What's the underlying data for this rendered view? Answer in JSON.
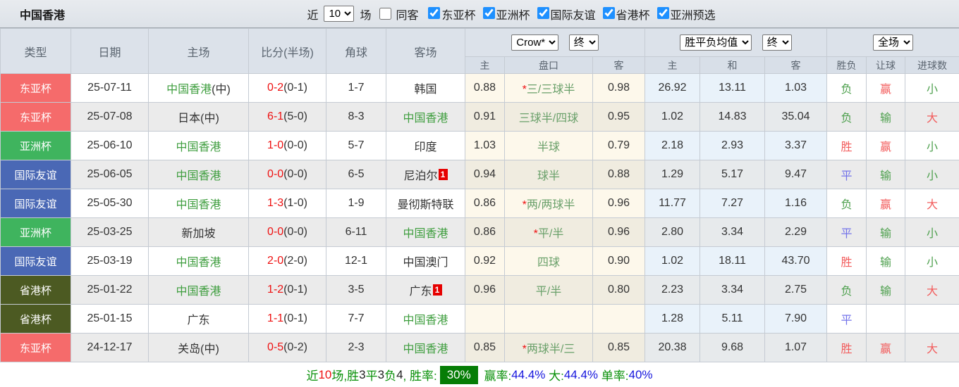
{
  "topbar": {
    "title": "中国香港",
    "recent_label": "近",
    "recent_value": "10",
    "games_label": "场",
    "same_venue": {
      "label": "同客",
      "checked": false
    },
    "leagues": [
      {
        "label": "东亚杯",
        "checked": true
      },
      {
        "label": "亚洲杯",
        "checked": true
      },
      {
        "label": "国际友谊",
        "checked": true
      },
      {
        "label": "省港杯",
        "checked": true
      },
      {
        "label": "亚洲预选",
        "checked": true
      }
    ]
  },
  "header": {
    "cols": [
      "类型",
      "日期",
      "主场",
      "比分(半场)",
      "角球",
      "客场"
    ],
    "crow_select": "Crow*",
    "crow_time_select": "终",
    "euro_select": "胜平负均值",
    "euro_time_select": "终",
    "period_select": "全场",
    "sub": [
      "主",
      "盘口",
      "客",
      "主",
      "和",
      "客",
      "胜负",
      "让球",
      "进球数"
    ]
  },
  "type_colors": {
    "东亚杯": "red",
    "亚洲杯": "green",
    "国际友谊": "blue",
    "省港杯": "olive"
  },
  "rows": [
    {
      "type": "东亚杯",
      "date": "25-07-11",
      "home": {
        "name": "中国香港",
        "suffix": "(中)",
        "green": true,
        "badge": ""
      },
      "score_ft": "0-2",
      "score_ht": "(0-1)",
      "corner": "1-7",
      "away": {
        "name": "韩国",
        "suffix": "",
        "green": false,
        "badge": ""
      },
      "crow_home": "0.88",
      "handicap": "*三/三球半",
      "crow_away": "0.98",
      "euro_home": "26.92",
      "euro_draw": "13.11",
      "euro_away": "1.03",
      "res_wdl": {
        "text": "负",
        "color": "green"
      },
      "res_handicap": {
        "text": "赢",
        "color": "red"
      },
      "res_goals": {
        "text": "小",
        "color": "green"
      }
    },
    {
      "type": "东亚杯",
      "date": "25-07-08",
      "home": {
        "name": "日本",
        "suffix": "(中)",
        "green": false,
        "badge": ""
      },
      "score_ft": "6-1",
      "score_ht": "(5-0)",
      "corner": "8-3",
      "away": {
        "name": "中国香港",
        "suffix": "",
        "green": true,
        "badge": ""
      },
      "crow_home": "0.91",
      "handicap": "三球半/四球",
      "crow_away": "0.95",
      "euro_home": "1.02",
      "euro_draw": "14.83",
      "euro_away": "35.04",
      "res_wdl": {
        "text": "负",
        "color": "green"
      },
      "res_handicap": {
        "text": "输",
        "color": "green"
      },
      "res_goals": {
        "text": "大",
        "color": "red"
      }
    },
    {
      "type": "亚洲杯",
      "date": "25-06-10",
      "home": {
        "name": "中国香港",
        "suffix": "",
        "green": true,
        "badge": ""
      },
      "score_ft": "1-0",
      "score_ht": "(0-0)",
      "corner": "5-7",
      "away": {
        "name": "印度",
        "suffix": "",
        "green": false,
        "badge": ""
      },
      "crow_home": "1.03",
      "handicap": "半球",
      "crow_away": "0.79",
      "euro_home": "2.18",
      "euro_draw": "2.93",
      "euro_away": "3.37",
      "res_wdl": {
        "text": "胜",
        "color": "red"
      },
      "res_handicap": {
        "text": "赢",
        "color": "red"
      },
      "res_goals": {
        "text": "小",
        "color": "green"
      }
    },
    {
      "type": "国际友谊",
      "date": "25-06-05",
      "home": {
        "name": "中国香港",
        "suffix": "",
        "green": true,
        "badge": ""
      },
      "score_ft": "0-0",
      "score_ht": "(0-0)",
      "corner": "6-5",
      "away": {
        "name": "尼泊尔",
        "suffix": "",
        "green": false,
        "badge": "1"
      },
      "crow_home": "0.94",
      "handicap": "球半",
      "crow_away": "0.88",
      "euro_home": "1.29",
      "euro_draw": "5.17",
      "euro_away": "9.47",
      "res_wdl": {
        "text": "平",
        "color": "blue"
      },
      "res_handicap": {
        "text": "输",
        "color": "green"
      },
      "res_goals": {
        "text": "小",
        "color": "green"
      }
    },
    {
      "type": "国际友谊",
      "date": "25-05-30",
      "home": {
        "name": "中国香港",
        "suffix": "",
        "green": true,
        "badge": ""
      },
      "score_ft": "1-3",
      "score_ht": "(1-0)",
      "corner": "1-9",
      "away": {
        "name": "曼彻斯特联",
        "suffix": "",
        "green": false,
        "badge": ""
      },
      "crow_home": "0.86",
      "handicap": "*两/两球半",
      "crow_away": "0.96",
      "euro_home": "11.77",
      "euro_draw": "7.27",
      "euro_away": "1.16",
      "res_wdl": {
        "text": "负",
        "color": "green"
      },
      "res_handicap": {
        "text": "赢",
        "color": "red"
      },
      "res_goals": {
        "text": "大",
        "color": "red"
      }
    },
    {
      "type": "亚洲杯",
      "date": "25-03-25",
      "home": {
        "name": "新加坡",
        "suffix": "",
        "green": false,
        "badge": ""
      },
      "score_ft": "0-0",
      "score_ht": "(0-0)",
      "corner": "6-11",
      "away": {
        "name": "中国香港",
        "suffix": "",
        "green": true,
        "badge": ""
      },
      "crow_home": "0.86",
      "handicap": "*平/半",
      "crow_away": "0.96",
      "euro_home": "2.80",
      "euro_draw": "3.34",
      "euro_away": "2.29",
      "res_wdl": {
        "text": "平",
        "color": "blue"
      },
      "res_handicap": {
        "text": "输",
        "color": "green"
      },
      "res_goals": {
        "text": "小",
        "color": "green"
      }
    },
    {
      "type": "国际友谊",
      "date": "25-03-19",
      "home": {
        "name": "中国香港",
        "suffix": "",
        "green": true,
        "badge": ""
      },
      "score_ft": "2-0",
      "score_ht": "(2-0)",
      "corner": "12-1",
      "away": {
        "name": "中国澳门",
        "suffix": "",
        "green": false,
        "badge": ""
      },
      "crow_home": "0.92",
      "handicap": "四球",
      "crow_away": "0.90",
      "euro_home": "1.02",
      "euro_draw": "18.11",
      "euro_away": "43.70",
      "res_wdl": {
        "text": "胜",
        "color": "red"
      },
      "res_handicap": {
        "text": "输",
        "color": "green"
      },
      "res_goals": {
        "text": "小",
        "color": "green"
      }
    },
    {
      "type": "省港杯",
      "date": "25-01-22",
      "home": {
        "name": "中国香港",
        "suffix": "",
        "green": true,
        "badge": ""
      },
      "score_ft": "1-2",
      "score_ht": "(0-1)",
      "corner": "3-5",
      "away": {
        "name": "广东",
        "suffix": "",
        "green": false,
        "badge": "1"
      },
      "crow_home": "0.96",
      "handicap": "平/半",
      "crow_away": "0.80",
      "euro_home": "2.23",
      "euro_draw": "3.34",
      "euro_away": "2.75",
      "res_wdl": {
        "text": "负",
        "color": "green"
      },
      "res_handicap": {
        "text": "输",
        "color": "green"
      },
      "res_goals": {
        "text": "大",
        "color": "red"
      }
    },
    {
      "type": "省港杯",
      "date": "25-01-15",
      "home": {
        "name": "广东",
        "suffix": "",
        "green": false,
        "badge": ""
      },
      "score_ft": "1-1",
      "score_ht": "(0-1)",
      "corner": "7-7",
      "away": {
        "name": "中国香港",
        "suffix": "",
        "green": true,
        "badge": ""
      },
      "crow_home": "",
      "handicap": "",
      "crow_away": "",
      "euro_home": "1.28",
      "euro_draw": "5.11",
      "euro_away": "7.90",
      "res_wdl": {
        "text": "平",
        "color": "blue"
      },
      "res_handicap": {
        "text": "",
        "color": "black"
      },
      "res_goals": {
        "text": "",
        "color": "black"
      }
    },
    {
      "type": "东亚杯",
      "date": "24-12-17",
      "home": {
        "name": "关岛",
        "suffix": "(中)",
        "green": false,
        "badge": ""
      },
      "score_ft": "0-5",
      "score_ht": "(0-2)",
      "corner": "2-3",
      "away": {
        "name": "中国香港",
        "suffix": "",
        "green": true,
        "badge": ""
      },
      "crow_home": "0.85",
      "handicap": "*两球半/三",
      "crow_away": "0.85",
      "euro_home": "20.38",
      "euro_draw": "9.68",
      "euro_away": "1.07",
      "res_wdl": {
        "text": "胜",
        "color": "red"
      },
      "res_handicap": {
        "text": "赢",
        "color": "red"
      },
      "res_goals": {
        "text": "大",
        "color": "red"
      }
    }
  ],
  "summary": {
    "segments": [
      {
        "text": "近",
        "style": "green"
      },
      {
        "text": "10",
        "style": "red"
      },
      {
        "text": "场,胜",
        "style": "green"
      },
      {
        "text": "3",
        "style": "black"
      },
      {
        "text": "平",
        "style": "green"
      },
      {
        "text": "3",
        "style": "black"
      },
      {
        "text": "负",
        "style": "green"
      },
      {
        "text": "4",
        "style": "black"
      },
      {
        "text": ", 胜率:",
        "style": "green"
      },
      {
        "text": "30%",
        "style": "badge"
      },
      {
        "text": " 赢率:",
        "style": "green"
      },
      {
        "text": "44.4%",
        "style": "blue"
      },
      {
        "text": " 大:",
        "style": "green"
      },
      {
        "text": "44.4%",
        "style": "blue"
      },
      {
        "text": " 单率:",
        "style": "green"
      },
      {
        "text": "40%",
        "style": "blue"
      }
    ]
  }
}
